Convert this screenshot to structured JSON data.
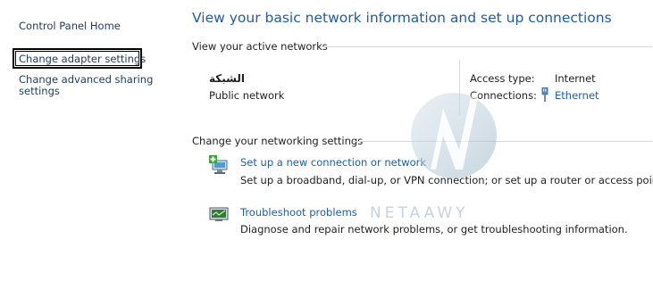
{
  "sidebar": {
    "home_label": "Control Panel Home",
    "items": [
      {
        "label": "Change adapter settings"
      },
      {
        "label": "Change advanced sharing\nsettings"
      }
    ]
  },
  "main": {
    "title": "View your basic network information and set up connections",
    "active_networks_heading": "View your active networks",
    "network": {
      "name": "الشبكة",
      "category": "Public network",
      "access_type_label": "Access type:",
      "access_type_value": "Internet",
      "connections_label": "Connections:",
      "connections_value": "Ethernet"
    },
    "change_settings_heading": "Change your networking settings",
    "tasks": [
      {
        "icon": "new-connection-icon",
        "link": "Set up a new connection or network",
        "description": "Set up a broadband, dial-up, or VPN connection; or set up a router or access point."
      },
      {
        "icon": "troubleshoot-icon",
        "link": "Troubleshoot problems",
        "description": "Diagnose and repair network problems, or get troubleshooting information."
      }
    ]
  },
  "watermark": {
    "text": "NETAAWY"
  },
  "colors": {
    "link": "#1c5ea8",
    "title": "#1e5bab",
    "divider": "#d7d7d7"
  }
}
